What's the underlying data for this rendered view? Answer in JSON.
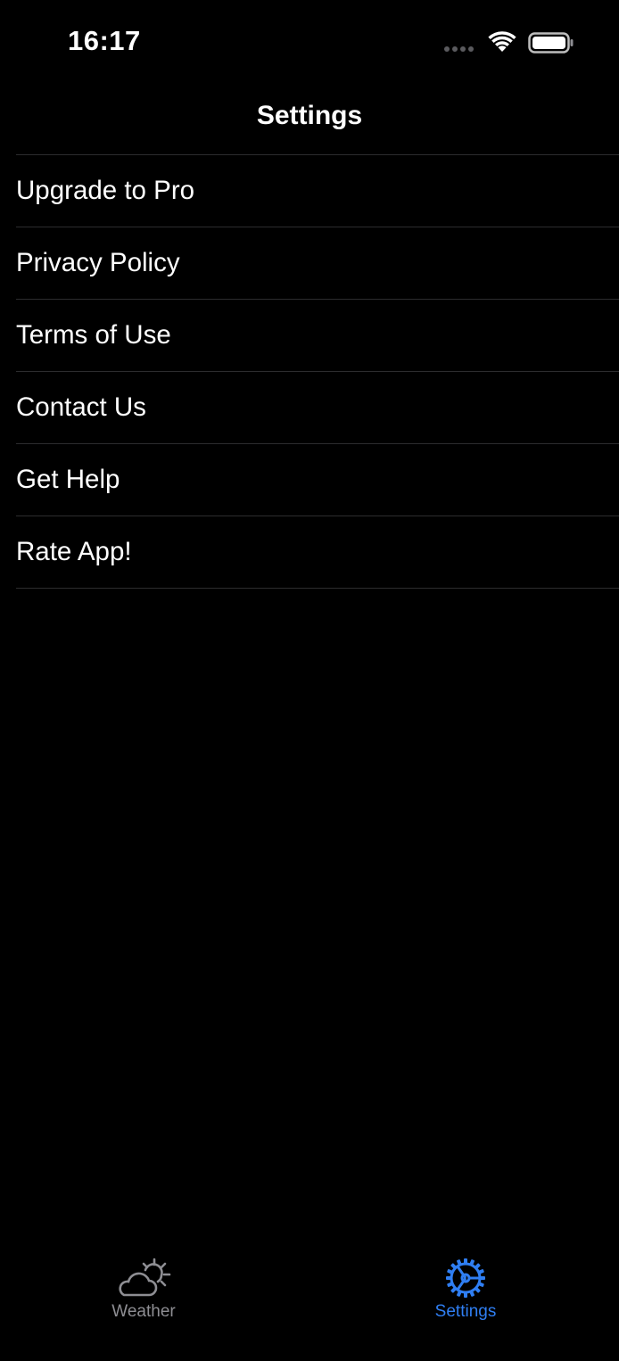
{
  "status_bar": {
    "time": "16:17"
  },
  "nav": {
    "title": "Settings"
  },
  "menu": {
    "items": [
      {
        "label": "Upgrade to Pro"
      },
      {
        "label": "Privacy Policy"
      },
      {
        "label": "Terms of Use"
      },
      {
        "label": "Contact Us"
      },
      {
        "label": "Get Help"
      },
      {
        "label": "Rate App!"
      }
    ]
  },
  "tab_bar": {
    "tabs": [
      {
        "label": "Weather",
        "icon": "cloud-sun-icon",
        "selected": false
      },
      {
        "label": "Settings",
        "icon": "gear-icon",
        "selected": true
      }
    ],
    "active_color": "#2f7ef2",
    "inactive_color": "#8e8e93"
  }
}
